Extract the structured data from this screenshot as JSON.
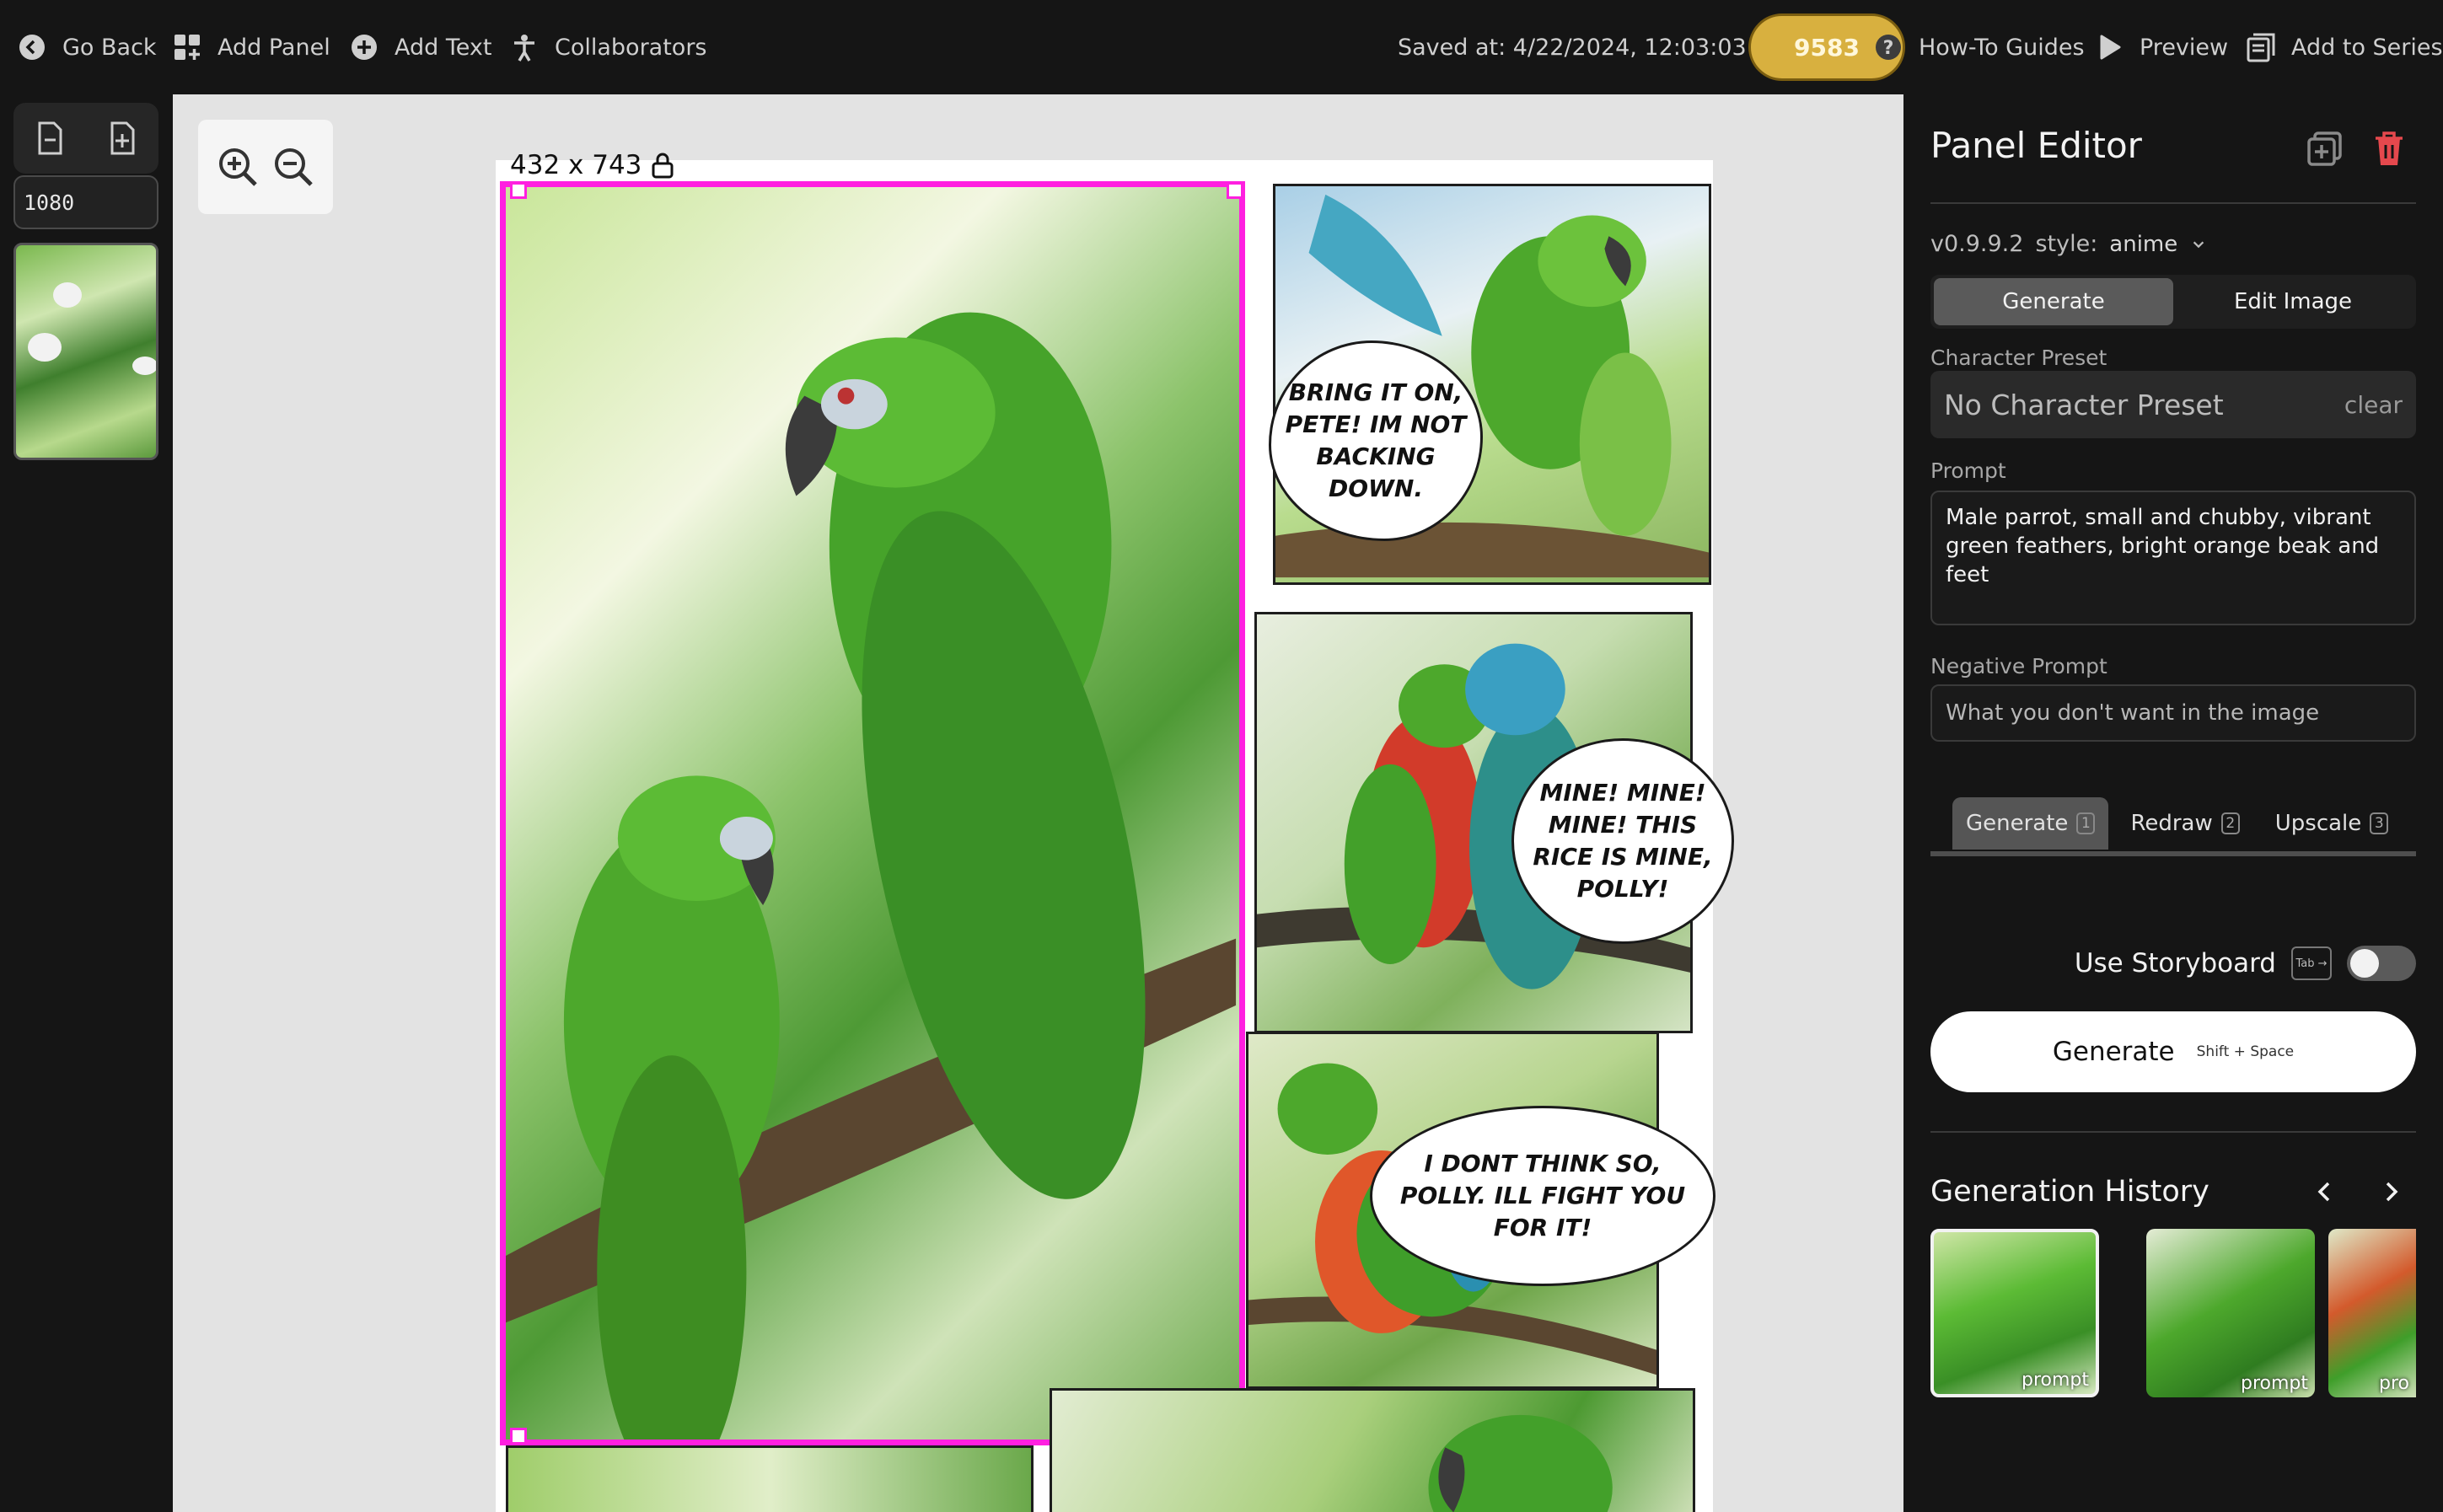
{
  "topbar": {
    "go_back": "Go Back",
    "add_panel": "Add Panel",
    "add_text": "Add Text",
    "collaborators": "Collaborators",
    "saved_at": "Saved at: 4/22/2024, 12:03:03 PM",
    "credits": "9583",
    "guides": "How-To Guides",
    "preview": "Preview",
    "add_to_series": "Add to Series"
  },
  "leftbar": {
    "page_width": "1080"
  },
  "canvas": {
    "dimensions": "432 x 743",
    "bubbles": {
      "b1": "Bring it on, Pete! Im not backing down.",
      "b2": "Mine! Mine! Mine! This rice is mine, Polly!",
      "b3": "I dont think so, Polly. Ill fight you for it!"
    }
  },
  "editor": {
    "title": "Panel Editor",
    "version": "v0.9.9.2",
    "style_label": "style:",
    "style_value": "anime",
    "mode_tabs": [
      "Generate",
      "Edit Image"
    ],
    "character_preset_label": "Character Preset",
    "character_preset_value": "No Character Preset",
    "clear_label": "clear",
    "prompt_label": "Prompt",
    "prompt_value": "Male parrot, small and chubby, vibrant green feathers, bright orange beak and feet",
    "negative_prompt_label": "Negative Prompt",
    "negative_prompt_placeholder": "What you don't want in the image",
    "gen_tabs": [
      {
        "label": "Generate",
        "key": "1"
      },
      {
        "label": "Redraw",
        "key": "2"
      },
      {
        "label": "Upscale",
        "key": "3"
      }
    ],
    "storyboard_label": "Use Storyboard",
    "storyboard_key": "Tab →",
    "storyboard_enabled": false,
    "generate_label": "Generate",
    "generate_hint": "Shift + Space",
    "history_title": "Generation History",
    "history_items": [
      {
        "caption": "prompt"
      },
      {
        "caption": "prompt"
      },
      {
        "caption": "pro"
      }
    ]
  },
  "colors": {
    "selection": "#ff1fe0",
    "credits_bg": "#d8b03f",
    "delete_icon": "#e5484d"
  }
}
